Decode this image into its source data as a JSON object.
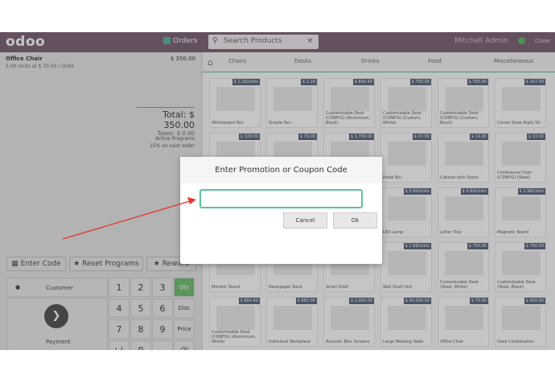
{
  "topbar": {
    "logo": "odoo",
    "orders": "Orders",
    "search_placeholder": "Search Products",
    "close_x": "×",
    "user": "Mitchell Admin",
    "close": "Close"
  },
  "order": {
    "product": "Office Chair",
    "price": "$ 350.00",
    "detail": "5.00 Units at $ 70.00 / Units",
    "total": "Total: $ 350.00",
    "taxes": "Taxes: $ 0.00",
    "promo_title": "Active Programs",
    "promo_line": "15% on next order"
  },
  "controls": {
    "enter_code": "Enter Code",
    "reset": "Reset Programs",
    "reward": "Reward"
  },
  "numpad": {
    "customer": "Customer",
    "payment": "Payment",
    "keys": [
      "1",
      "2",
      "3",
      "Qty",
      "4",
      "5",
      "6",
      "Disc",
      "7",
      "8",
      "9",
      "Price",
      "+/-",
      "0",
      ".",
      "⌫"
    ]
  },
  "categories": [
    "Chairs",
    "Desks",
    "Drinks",
    "Food",
    "Miscellaneous"
  ],
  "products": [
    {
      "name": "Whiteboard Pen",
      "price": "$ 1.20/Units"
    },
    {
      "name": "Simple Pen",
      "price": "$ 1.20"
    },
    {
      "name": "Customizable Desk (CONFIG) (Aluminium, Black)",
      "price": "$ 800.40"
    },
    {
      "name": "Customizable Desk (CONFIG) (Custom, White)",
      "price": "$ 750.00"
    },
    {
      "name": "Customizable Desk (CONFIG) (Custom, Black)",
      "price": "$ 750.00"
    },
    {
      "name": "Corner Desk Right Sit",
      "price": "$ 147.00"
    },
    {
      "name": "",
      "price": "$ 328.00"
    },
    {
      "name": "",
      "price": "$ 79.00"
    },
    {
      "name": "",
      "price": "$ 1,799.00"
    },
    {
      "name": "Pedal Bin",
      "price": "$ 47.00"
    },
    {
      "name": "Cabinet with Doors",
      "price": "$ 14.00"
    },
    {
      "name": "Conference Chair (CONFIG) (Steel)",
      "price": "$ 33.00"
    },
    {
      "name": "",
      "price": ""
    },
    {
      "name": "",
      "price": ""
    },
    {
      "name": "",
      "price": ""
    },
    {
      "name": "LED Lamp",
      "price": "$ 0.90/Units"
    },
    {
      "name": "Letter Tray",
      "price": "$ 4.80/Units"
    },
    {
      "name": "Magnetic Board",
      "price": "$ 1.98/Units"
    },
    {
      "name": "Monitor Stand",
      "price": "$ 3.19/Units"
    },
    {
      "name": "Newspaper Rack",
      "price": "$ 1.28/Units"
    },
    {
      "name": "Small Shelf",
      "price": "$ 2.83/Units"
    },
    {
      "name": "Wall Shelf Unit",
      "price": "$ 1.98/Units"
    },
    {
      "name": "Customizable Desk (Steel, White)",
      "price": "$ 750.00"
    },
    {
      "name": "Customizable Desk (Steel, Black)",
      "price": "$ 750.00"
    },
    {
      "name": "Customizable Desk (CONFIG) (Aluminium, White)",
      "price": "$ 800.40"
    },
    {
      "name": "Individual Workplace",
      "price": "$ 885.00"
    },
    {
      "name": "Acoustic Bloc Screens",
      "price": "$ 2,950.00"
    },
    {
      "name": "Large Meeting Table",
      "price": "$ 40,000.00"
    },
    {
      "name": "Office Chair",
      "price": "$ 70.00"
    },
    {
      "name": "Desk Combination",
      "price": "$ 450.00"
    }
  ],
  "dialog": {
    "title": "Enter Promotion or Coupon Code",
    "input_value": "",
    "cancel": "Cancel",
    "ok": "Ok"
  },
  "colors": {
    "topbar": "#6b4e64",
    "accent": "#5cc2a0",
    "arrow": "#e53935"
  }
}
